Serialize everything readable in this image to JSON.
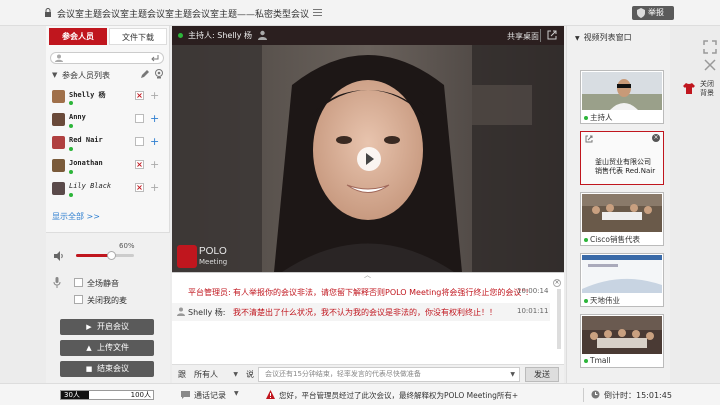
{
  "window": {
    "title": "会议室主题会议室主题会议室主题会议室主题——私密类型会议",
    "report_label": "举报"
  },
  "left_panel": {
    "tabs": [
      {
        "label": "参会人员",
        "active": true
      },
      {
        "label": "文件下载",
        "active": false
      }
    ],
    "search_placeholder": "",
    "list_title": "参会人员列表",
    "participants": [
      {
        "name": "Shelly 杨",
        "avatar_color": "#a0704a",
        "muted": true,
        "plus_color": "#aaaaaa"
      },
      {
        "name": "Anny",
        "avatar_color": "#6a4a3a",
        "muted": false,
        "plus_color": "#2f7fd0"
      },
      {
        "name": "Red Nair",
        "avatar_color": "#b04040",
        "muted": false,
        "plus_color": "#2f7fd0"
      },
      {
        "name": "Jonathan",
        "avatar_color": "#7a5a3a",
        "muted": true,
        "plus_color": "#aaaaaa"
      },
      {
        "name": "Lily Black",
        "avatar_color": "#5a4a4a",
        "muted": true,
        "plus_color": "#aaaaaa"
      }
    ],
    "show_all": "显示全部 >>",
    "volume_percent": 60,
    "volume_label": "60%",
    "checkboxes": [
      {
        "label": "全场静音",
        "checked": false
      },
      {
        "label": "关闭我的麦",
        "checked": false
      }
    ],
    "buttons": [
      {
        "label": "开启会议",
        "icon": "play-icon"
      },
      {
        "label": "上传文件",
        "icon": "upload-icon"
      },
      {
        "label": "结束会议",
        "icon": "stop-icon"
      }
    ]
  },
  "video": {
    "host_label": "主持人: Shelly 杨",
    "share_label": "共享桌面",
    "watermark_brand": "POLO",
    "watermark_sub": "Meeting"
  },
  "chat": {
    "messages": [
      {
        "sender": "平台管理员:",
        "text": "有人举报你的会议非法，请您留下解释否则POLO Meeting将会强行终止您的会议\"！",
        "time": "10:00:14",
        "sender_color": "#c0161e",
        "icon": false
      },
      {
        "sender": "Shelly 杨:",
        "text": "我不清楚出了什么状况，我不认为我的会议是非法的，你没有权利终止！！",
        "time": "10:01:11",
        "sender_color": "#555555",
        "icon": true
      }
    ],
    "recipient_label": "跟",
    "recipient": "所有人",
    "say_label": "说",
    "input_placeholder": "会议还有15分钟结束，轻率发言的代表尽快做准备",
    "send_label": "发送"
  },
  "right_panel": {
    "title": "视频列表窗口",
    "thumbs": [
      {
        "label": "主持人",
        "selected": false
      },
      {
        "label": "釜山贸业有限公司 销售代表 Red.Nair",
        "selected": true
      },
      {
        "label": "Cisco销售代表",
        "selected": false
      },
      {
        "label": "天地伟业",
        "selected": false
      },
      {
        "label": "Tmall",
        "selected": false
      }
    ]
  },
  "side": {
    "bg_label_1": "关闭",
    "bg_label_2": "背景"
  },
  "status": {
    "capacity_min": "30人",
    "capacity_max": "100人",
    "capacity_fraction": 0.3,
    "records_label": "通话记录",
    "notice": "您好，平台管理员经过了此次会议，最终解释权为POLO Meeting所有+",
    "countdown_label": "倒计时：",
    "countdown": "15:01:45"
  }
}
